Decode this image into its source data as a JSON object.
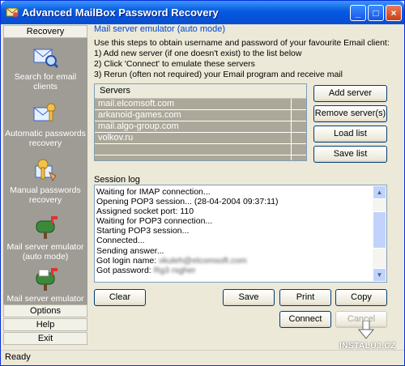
{
  "window": {
    "title": "Advanced MailBox Password Recovery"
  },
  "sidebar": {
    "header": "Recovery",
    "items": [
      {
        "label": "Search for email clients",
        "icon": "search-mail-icon"
      },
      {
        "label": "Automatic passwords recovery",
        "icon": "key-mail-icon"
      },
      {
        "label": "Manual passwords recovery",
        "icon": "manual-key-icon"
      },
      {
        "label": "Mail server emulator (auto mode)",
        "icon": "mailbox-icon"
      },
      {
        "label": "Mail server emulator (manual mode)",
        "icon": "mailbox-manual-icon"
      }
    ],
    "bottom": [
      "Options",
      "Help",
      "Exit"
    ]
  },
  "main": {
    "section_title": "Mail server emulator (auto mode)",
    "instructions": [
      "Use this steps to obtain username and password of your favourite Email client:",
      "1) Add new server (if one doesn't exist) to the list below",
      "2) Click 'Connect' to emulate these servers",
      "3) Rerun (often not required) your Email program and receive mail"
    ],
    "servers_header": "Servers",
    "servers": [
      "mail.elcomsoft.com",
      "arkanoid-games.com",
      "mail.algo-group.com",
      "volkov.ru"
    ],
    "buttons": {
      "add_server": "Add server",
      "remove_server": "Remove server(s)",
      "load_list": "Load list",
      "save_list": "Save list",
      "clear": "Clear",
      "save": "Save",
      "print": "Print",
      "copy": "Copy",
      "connect": "Connect",
      "cancel": "Cancel"
    },
    "log_label": "Session log",
    "log_lines": [
      "Waiting for IMAP connection...",
      "Opening POP3 session... (28-04-2004  09:37:11)",
      "Assigned socket port: 110",
      "Waiting for POP3 connection...",
      "Starting POP3 session...",
      "Connected...",
      "Sending answer...",
      "Got login name:",
      "Got password:"
    ],
    "log_login_value": "vkuleh@elcomsoft.com",
    "log_password_value": "Rg3 rsgher"
  },
  "status": {
    "text": "Ready"
  },
  "watermark": {
    "text": "INSTALUJ.CZ"
  }
}
